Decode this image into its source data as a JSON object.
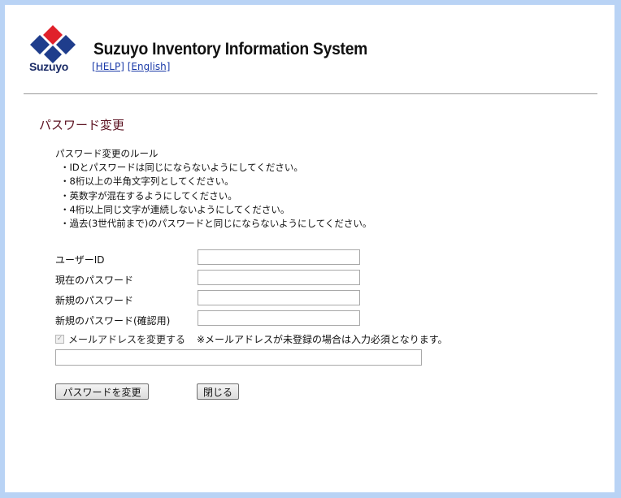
{
  "brand": {
    "name": "Suzuyo",
    "colors": {
      "top": "#e0202a",
      "left": "#1f3d8c",
      "right": "#1f3d8c",
      "bottom": "#1f3d8c"
    }
  },
  "header": {
    "title": "Suzuyo Inventory Information System",
    "help_link": "[HELP]",
    "english_link": "[English]"
  },
  "page": {
    "title": "パスワード変更"
  },
  "rules": {
    "heading": "パスワード変更のルール",
    "items": [
      "・IDとパスワードは同じにならないようにしてください。",
      "・8桁以上の半角文字列としてください。",
      "・英数字が混在するようにしてください。",
      "・4桁以上同じ文字が連続しないようにしてください。",
      "・過去(3世代前まで)のパスワードと同じにならないようにしてください。"
    ]
  },
  "form": {
    "user_id_label": "ユーザーID",
    "user_id_value": "",
    "current_password_label": "現在のパスワード",
    "current_password_value": "",
    "new_password_label": "新規のパスワード",
    "new_password_value": "",
    "confirm_password_label": "新規のパスワード(確認用)",
    "confirm_password_value": "",
    "change_email_label": "メールアドレスを変更する",
    "change_email_checked": true,
    "email_note": "※メールアドレスが未登録の場合は入力必須となります。",
    "email_value": ""
  },
  "buttons": {
    "change_password": "パスワードを変更",
    "close": "閉じる"
  }
}
